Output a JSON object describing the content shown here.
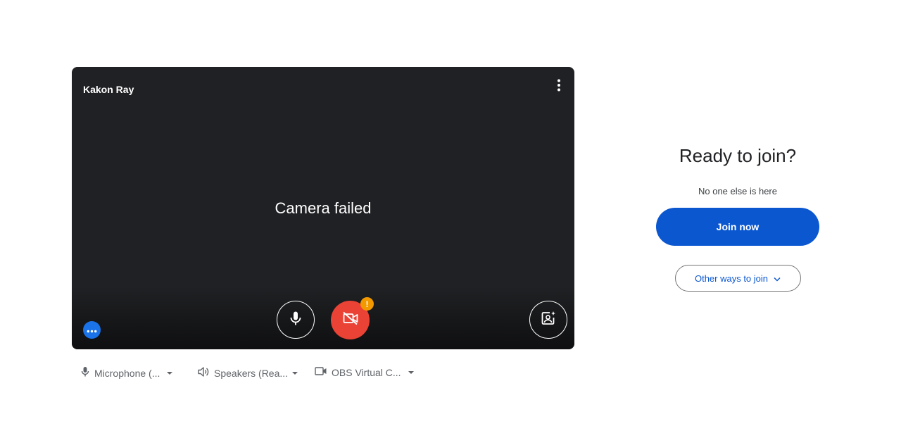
{
  "preview": {
    "participant_name": "Kakon Ray",
    "status_text": "Camera failed",
    "warning_badge": "!",
    "icons": {
      "options": "more-vert-icon",
      "microphone": "mic-icon",
      "camera": "videocam-off-icon",
      "effects": "visual-effects-icon",
      "more": "more-horiz-icon"
    },
    "colors": {
      "camera_off": "#ea4335",
      "warning": "#f29900",
      "more_button": "#1a73e8"
    }
  },
  "devices": [
    {
      "label": "Microphone (...",
      "icon": "mic-icon"
    },
    {
      "label": "Speakers (Rea...",
      "icon": "speaker-icon"
    },
    {
      "label": "OBS Virtual C...",
      "icon": "videocam-icon"
    }
  ],
  "join": {
    "title": "Ready to join?",
    "subtitle": "No one else is here",
    "join_label": "Join now",
    "other_label": "Other ways to join",
    "primary_color": "#0b57d0"
  }
}
